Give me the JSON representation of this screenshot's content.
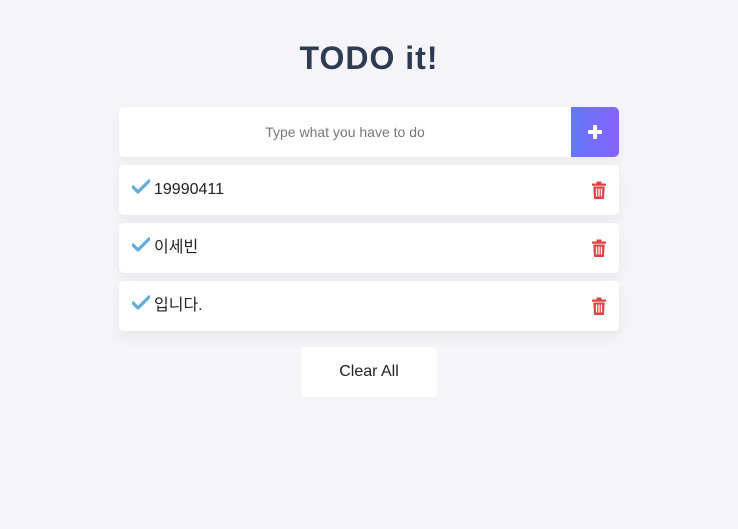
{
  "header": {
    "title": "TODO it!"
  },
  "input": {
    "placeholder": "Type what you have to do",
    "value": "",
    "add_icon": "plus-icon"
  },
  "todos": [
    {
      "text": "19990411",
      "checked": true,
      "check_icon": "check-icon",
      "delete_icon": "trash-icon"
    },
    {
      "text": "이세빈",
      "checked": true,
      "check_icon": "check-icon",
      "delete_icon": "trash-icon"
    },
    {
      "text": "입니다.",
      "checked": true,
      "check_icon": "check-icon",
      "delete_icon": "trash-icon"
    }
  ],
  "footer": {
    "clear_label": "Clear All"
  },
  "colors": {
    "background": "#f5f5f7",
    "title": "#2f3b52",
    "accent_start": "#6478fb",
    "accent_end": "#8763fb",
    "check": "#62acde",
    "delete": "#de4343"
  }
}
